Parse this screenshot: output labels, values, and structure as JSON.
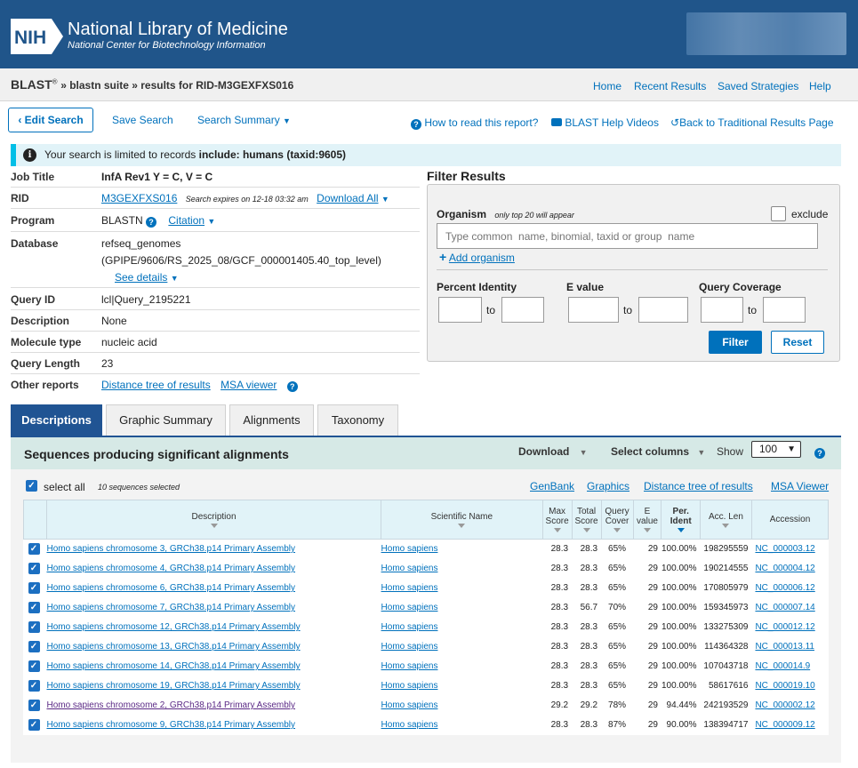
{
  "header": {
    "logo_text": "NIH",
    "title": "National Library of Medicine",
    "subtitle": "National Center for Biotechnology Information"
  },
  "breadcrumb": {
    "blast": "BLAST",
    "reg": "®",
    "suite": "» blastn suite » results for RID-M3GEXFXS016"
  },
  "topnav": [
    "Home",
    "Recent Results",
    "Saved Strategies",
    "Help"
  ],
  "toolbar": {
    "edit_search": "Edit Search",
    "save_search": "Save Search",
    "search_summary": "Search Summary",
    "how_to_read": "How to read this report?",
    "help_videos": "BLAST Help Videos",
    "back_traditional": "Back to Traditional Results Page"
  },
  "notice": {
    "prefix": "Your search is limited to records",
    "bold": "include: humans (taxid:9605)"
  },
  "summary": {
    "job_title_label": "Job Title",
    "job_title": "InfA Rev1 Y = C, V = C",
    "rid_label": "RID",
    "rid": "M3GEXFXS016",
    "rid_expires": "Search expires on 12-18 03:32 am",
    "download_all": "Download All",
    "program_label": "Program",
    "program": "BLASTN",
    "citation": "Citation",
    "database_label": "Database",
    "database_line1": "refseq_genomes",
    "database_line2": "(GPIPE/9606/RS_2025_08/GCF_000001405.40_top_level)",
    "see_details": "See details",
    "query_id_label": "Query ID",
    "query_id": "lcl|Query_2195221",
    "description_label": "Description",
    "description": "None",
    "molecule_type_label": "Molecule type",
    "molecule_type": "nucleic acid",
    "query_length_label": "Query Length",
    "query_length": "23",
    "other_reports_label": "Other reports",
    "distance_tree": "Distance tree of results",
    "msa_viewer": "MSA viewer"
  },
  "filter": {
    "title": "Filter Results",
    "organism_label": "Organism",
    "organism_note": "only top 20 will appear",
    "exclude_label": "exclude",
    "organism_placeholder": "Type common  name, binomial, taxid or group  name",
    "add_organism": "Add organism",
    "percent_identity": "Percent Identity",
    "e_value": "E value",
    "query_coverage": "Query Coverage",
    "to": "to",
    "filter_button": "Filter",
    "reset_button": "Reset"
  },
  "tabs": [
    "Descriptions",
    "Graphic Summary",
    "Alignments",
    "Taxonomy"
  ],
  "results_bar": {
    "title": "Sequences producing significant alignments",
    "download": "Download",
    "select_columns": "Select columns",
    "show": "Show",
    "show_value": "100"
  },
  "select_row": {
    "select_all": "select all",
    "selected_count": "10 sequences selected",
    "links": [
      "GenBank",
      "Graphics",
      "Distance tree of results",
      "MSA Viewer"
    ]
  },
  "table": {
    "headers": {
      "description": "Description",
      "scientific_name": "Scientific Name",
      "max_score": [
        "Max",
        "Score"
      ],
      "total_score": [
        "Total",
        "Score"
      ],
      "query_cover": [
        "Query",
        "Cover"
      ],
      "e_value": [
        "E",
        "value"
      ],
      "per_ident": [
        "Per.",
        "Ident"
      ],
      "acc_len": "Acc. Len",
      "accession": "Accession"
    },
    "rows": [
      {
        "description": "Homo sapiens chromosome 3, GRCh38.p14 Primary Assembly",
        "sci": "Homo sapiens",
        "max": "28.3",
        "total": "28.3",
        "cover": "65%",
        "evalue": "29",
        "ident": "100.00%",
        "len": "198295559",
        "acc": "NC_000003.12",
        "visited": false
      },
      {
        "description": "Homo sapiens chromosome 4, GRCh38.p14 Primary Assembly",
        "sci": "Homo sapiens",
        "max": "28.3",
        "total": "28.3",
        "cover": "65%",
        "evalue": "29",
        "ident": "100.00%",
        "len": "190214555",
        "acc": "NC_000004.12",
        "visited": false
      },
      {
        "description": "Homo sapiens chromosome 6, GRCh38.p14 Primary Assembly",
        "sci": "Homo sapiens",
        "max": "28.3",
        "total": "28.3",
        "cover": "65%",
        "evalue": "29",
        "ident": "100.00%",
        "len": "170805979",
        "acc": "NC_000006.12",
        "visited": false
      },
      {
        "description": "Homo sapiens chromosome 7, GRCh38.p14 Primary Assembly",
        "sci": "Homo sapiens",
        "max": "28.3",
        "total": "56.7",
        "cover": "70%",
        "evalue": "29",
        "ident": "100.00%",
        "len": "159345973",
        "acc": "NC_000007.14",
        "visited": false
      },
      {
        "description": "Homo sapiens chromosome 12, GRCh38.p14 Primary Assembly",
        "sci": "Homo sapiens",
        "max": "28.3",
        "total": "28.3",
        "cover": "65%",
        "evalue": "29",
        "ident": "100.00%",
        "len": "133275309",
        "acc": "NC_000012.12",
        "visited": false
      },
      {
        "description": "Homo sapiens chromosome 13, GRCh38.p14 Primary Assembly",
        "sci": "Homo sapiens",
        "max": "28.3",
        "total": "28.3",
        "cover": "65%",
        "evalue": "29",
        "ident": "100.00%",
        "len": "114364328",
        "acc": "NC_000013.11",
        "visited": false
      },
      {
        "description": "Homo sapiens chromosome 14, GRCh38.p14 Primary Assembly",
        "sci": "Homo sapiens",
        "max": "28.3",
        "total": "28.3",
        "cover": "65%",
        "evalue": "29",
        "ident": "100.00%",
        "len": "107043718",
        "acc": "NC_000014.9",
        "visited": false
      },
      {
        "description": "Homo sapiens chromosome 19, GRCh38.p14 Primary Assembly",
        "sci": "Homo sapiens",
        "max": "28.3",
        "total": "28.3",
        "cover": "65%",
        "evalue": "29",
        "ident": "100.00%",
        "len": "58617616",
        "acc": "NC_000019.10",
        "visited": false
      },
      {
        "description": "Homo sapiens chromosome 2, GRCh38.p14 Primary Assembly",
        "sci": "Homo sapiens",
        "max": "29.2",
        "total": "29.2",
        "cover": "78%",
        "evalue": "29",
        "ident": "94.44%",
        "len": "242193529",
        "acc": "NC_000002.12",
        "visited": true
      },
      {
        "description": "Homo sapiens chromosome 9, GRCh38.p14 Primary Assembly",
        "sci": "Homo sapiens",
        "max": "28.3",
        "total": "28.3",
        "cover": "87%",
        "evalue": "29",
        "ident": "90.00%",
        "len": "138394717",
        "acc": "NC_000009.12",
        "visited": false
      }
    ]
  },
  "colors": {
    "header_bg": "#20558a",
    "link": "#0071bc",
    "tab_active": "#205493",
    "results_bar": "#d6e9e6",
    "notice_bg": "#e1f3f8"
  }
}
